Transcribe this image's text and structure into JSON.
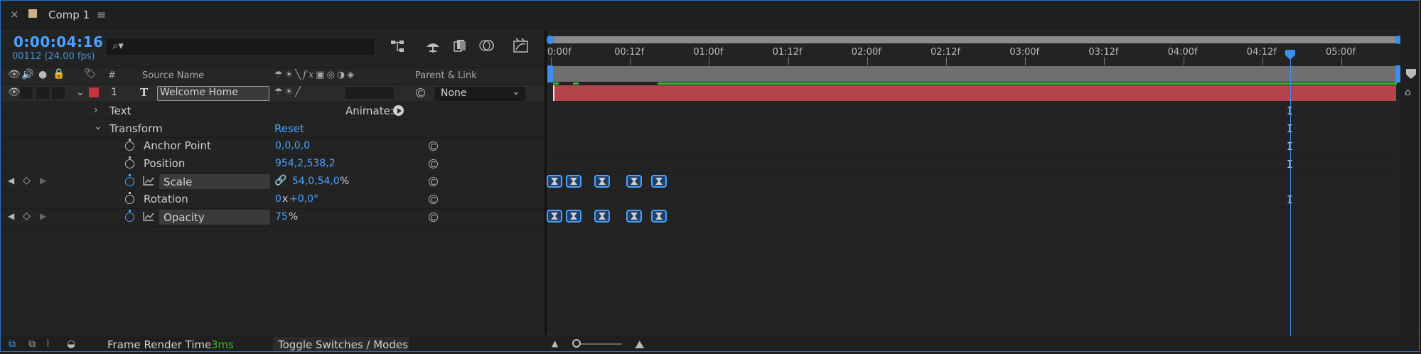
{
  "tab": {
    "close_glyph": "×",
    "title": "Comp 1",
    "menu_glyph": "≡",
    "swatch_color": "#c8b48a"
  },
  "time": {
    "timecode": "0:00:04:16",
    "frame_info": "00112 (24.00 fps)"
  },
  "search": {
    "icon": "search-icon",
    "glyph": "⌕▾",
    "value": ""
  },
  "header": {
    "source_name": "Source Name",
    "num": "#",
    "parent_link": "Parent & Link"
  },
  "layer": {
    "number": "1",
    "type_glyph": "T",
    "name": "Welcome Home",
    "label_color": "#c8353b",
    "parent_value": "None"
  },
  "properties": {
    "text": "Text",
    "animate": "Animate:",
    "transform": "Transform",
    "reset": "Reset",
    "anchor_point": {
      "label": "Anchor Point",
      "value": "0,0,0,0"
    },
    "position": {
      "label": "Position",
      "value": "954,2,538,2"
    },
    "scale": {
      "label": "Scale",
      "value": "54,0,54,0",
      "unit": "%"
    },
    "rotation": {
      "label": "Rotation",
      "value_x": "0",
      "sep": "x",
      "value_deg": "+0,0°"
    },
    "opacity": {
      "label": "Opacity",
      "value": "75",
      "unit": "%"
    }
  },
  "ruler": {
    "labels": [
      "0:00f",
      "00:12f",
      "01:00f",
      "01:12f",
      "02:00f",
      "02:12f",
      "03:00f",
      "03:12f",
      "04:00f",
      "04:12f",
      "05:00f"
    ]
  },
  "keyframes": {
    "scale_count": 5,
    "opacity_count": 5
  },
  "bottom": {
    "frame_render_label": "Frame Render Time",
    "frame_render_value": "3ms",
    "toggle": "Toggle Switches / Modes"
  },
  "colors": {
    "accent": "#4aa3ff",
    "layer_bar": "#b5434b",
    "render_value": "#2fbf2f"
  }
}
